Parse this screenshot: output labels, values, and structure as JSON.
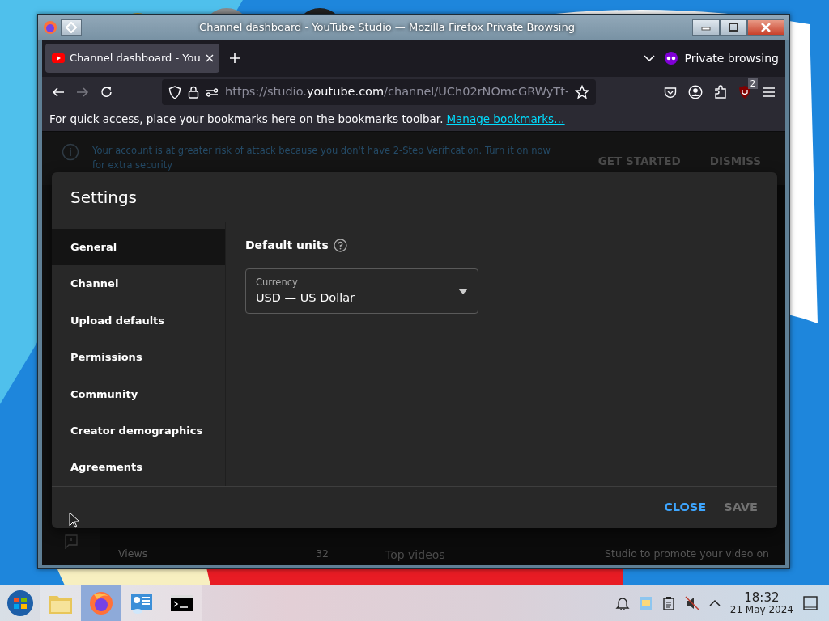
{
  "window": {
    "title": "Channel dashboard - YouTube Studio — Mozilla Firefox Private Browsing"
  },
  "tabs": [
    {
      "label": "Channel dashboard - You",
      "selected": true
    }
  ],
  "private_label": "Private browsing",
  "address": {
    "prefix": "https://studio.",
    "domain": "youtube.com",
    "path": "/channel/UCh02rNOmcGRWyTt-"
  },
  "extensions_badge": "2",
  "bookmarks_bar": {
    "text": "For quick access, place your bookmarks here on the bookmarks toolbar.",
    "link": "Manage bookmarks…"
  },
  "banner": {
    "text": "Your account is at greater risk of attack because you don't have 2-Step Verification. Turn it on now for extra security",
    "actions": [
      "GET STARTED",
      "DISMISS"
    ]
  },
  "dashboard": {
    "views_label": "Views",
    "views_value": "32",
    "top_videos": "Top videos",
    "promo": "Studio to promote your video on"
  },
  "dialog": {
    "title": "Settings",
    "nav": [
      {
        "label": "General",
        "selected": true
      },
      {
        "label": "Channel",
        "selected": false
      },
      {
        "label": "Upload defaults",
        "selected": false
      },
      {
        "label": "Permissions",
        "selected": false
      },
      {
        "label": "Community",
        "selected": false
      },
      {
        "label": "Creator demographics",
        "selected": false
      },
      {
        "label": "Agreements",
        "selected": false
      }
    ],
    "section_title": "Default units",
    "field": {
      "label": "Currency",
      "value": "USD — US Dollar"
    },
    "buttons": [
      {
        "label": "CLOSE",
        "disabled": false
      },
      {
        "label": "SAVE",
        "disabled": true
      }
    ]
  },
  "taskbar": {
    "apps": [
      {
        "kind": "folder",
        "selected": false
      },
      {
        "kind": "firefox",
        "selected": true
      },
      {
        "kind": "settings",
        "selected": false
      },
      {
        "kind": "terminal",
        "selected": false
      }
    ],
    "time": "18:32",
    "date": "21 May 2024"
  }
}
